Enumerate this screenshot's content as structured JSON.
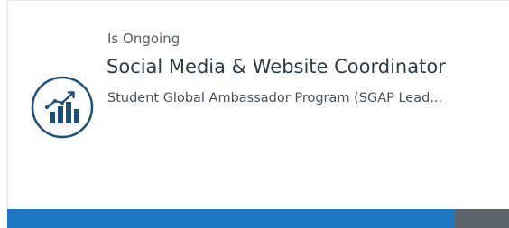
{
  "card": {
    "status": "Is Ongoing",
    "title": "Social Media & Website Coordinator",
    "subtitle": "Student Global Ambassador Program (SGAP Lead...",
    "icon": "bar-chart-growth-icon",
    "progress": 0.89
  },
  "colors": {
    "accent": "#1e78c2",
    "track": "#5d646c",
    "icon": "#1f4e79"
  }
}
